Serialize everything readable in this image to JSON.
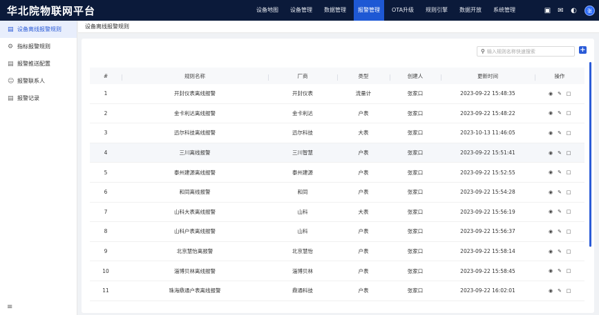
{
  "header": {
    "title": "华北院物联网平台",
    "nav": [
      "设备地图",
      "设备管理",
      "数据管理",
      "报警管理",
      "OTA升级",
      "规则引擎",
      "数据开放",
      "系统管理"
    ],
    "active_nav": "报警管理",
    "icons": [
      "notice-icon",
      "mail-icon",
      "theme-icon"
    ],
    "avatar_text": "张"
  },
  "sidebar": {
    "items": [
      {
        "label": "设备离线报警规则",
        "icon": "list-icon",
        "active": true
      },
      {
        "label": "指标报警规则",
        "icon": "rule-icon",
        "active": false
      },
      {
        "label": "报警推送配置",
        "icon": "config-icon",
        "active": false
      },
      {
        "label": "报警联系人",
        "icon": "contact-icon",
        "active": false
      },
      {
        "label": "报警记录",
        "icon": "record-icon",
        "active": false
      }
    ],
    "collapse_icon": "menu-icon"
  },
  "breadcrumb": "设备离线报警规则",
  "search": {
    "placeholder": "输入规则名称快速搜索"
  },
  "add_button": "+",
  "table": {
    "columns": [
      "#",
      "规则名称",
      "厂商",
      "类型",
      "创建人",
      "更新时间",
      "操作"
    ],
    "rows": [
      {
        "idx": "1",
        "name": "开封仪表离线报警",
        "vendor": "开封仪表",
        "type": "流量计",
        "creator": "张家口",
        "time": "2023-09-22 15:48:35"
      },
      {
        "idx": "2",
        "name": "金卡利达离线报警",
        "vendor": "金卡利达",
        "type": "户表",
        "creator": "张家口",
        "time": "2023-09-22 15:48:22"
      },
      {
        "idx": "3",
        "name": "迅尔科技离线报警",
        "vendor": "迅尔科技",
        "type": "大表",
        "creator": "张家口",
        "time": "2023-10-13 11:46:05"
      },
      {
        "idx": "4",
        "name": "三川离线报警",
        "vendor": "三川智慧",
        "type": "户表",
        "creator": "张家口",
        "time": "2023-09-22 15:51:41"
      },
      {
        "idx": "5",
        "name": "泰州建源离线报警",
        "vendor": "泰州建源",
        "type": "户表",
        "creator": "张家口",
        "time": "2023-09-22 15:52:55"
      },
      {
        "idx": "6",
        "name": "和同离线报警",
        "vendor": "和同",
        "type": "户表",
        "creator": "张家口",
        "time": "2023-09-22 15:54:28"
      },
      {
        "idx": "7",
        "name": "山科大表离线报警",
        "vendor": "山科",
        "type": "大表",
        "creator": "张家口",
        "time": "2023-09-22 15:56:19"
      },
      {
        "idx": "8",
        "name": "山科户表离线报警",
        "vendor": "山科",
        "type": "户表",
        "creator": "张家口",
        "time": "2023-09-22 15:56:37"
      },
      {
        "idx": "9",
        "name": "北京慧怡离报警",
        "vendor": "北京慧怡",
        "type": "户表",
        "creator": "张家口",
        "time": "2023-09-22 15:58:14"
      },
      {
        "idx": "10",
        "name": "淄博贝林离线报警",
        "vendor": "淄博贝林",
        "type": "户表",
        "creator": "张家口",
        "time": "2023-09-22 15:58:45"
      },
      {
        "idx": "11",
        "name": "珠海鼎通户表离线报警",
        "vendor": "鼎通科技",
        "type": "户表",
        "creator": "张家口",
        "time": "2023-09-22 16:02:01"
      }
    ],
    "highlight_row": 4,
    "row_actions": [
      "view-icon",
      "edit-icon",
      "delete-icon"
    ]
  }
}
